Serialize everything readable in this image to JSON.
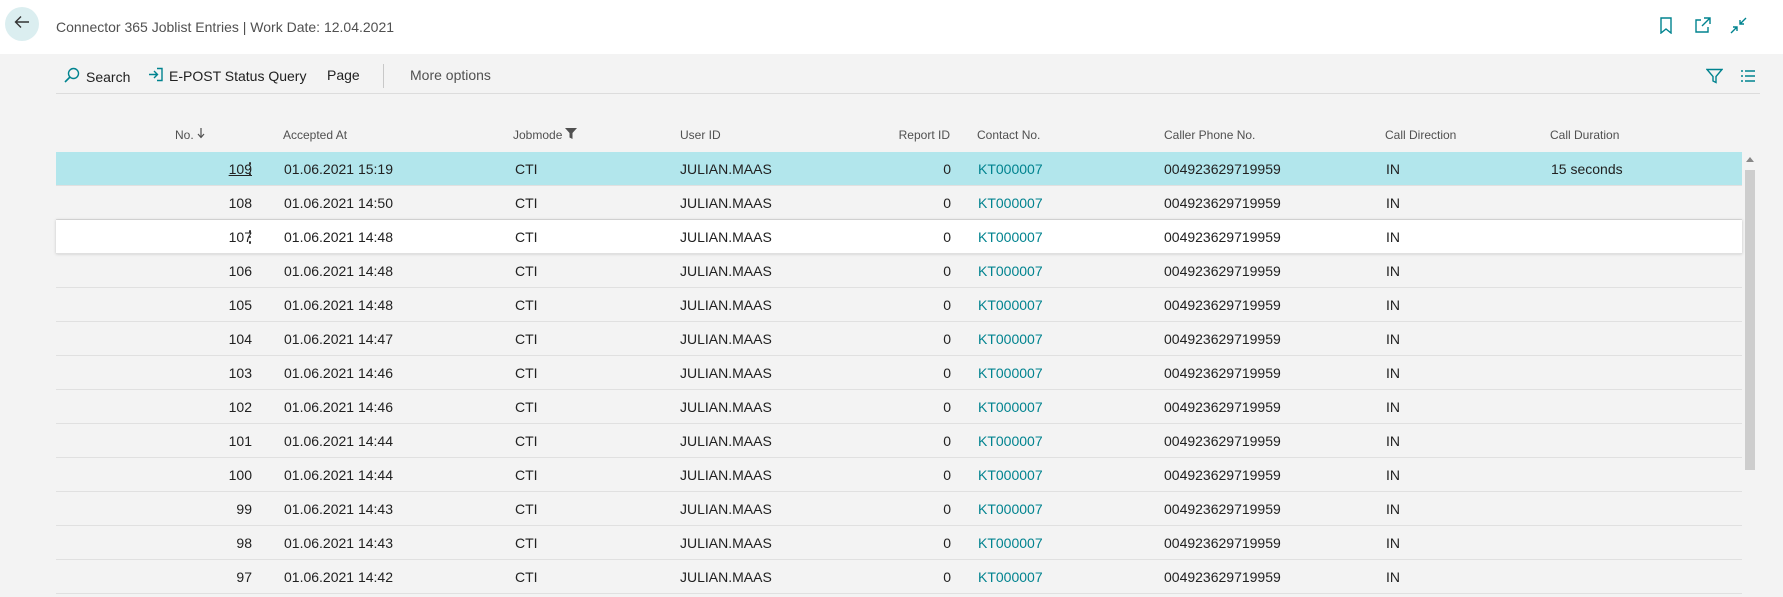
{
  "window": {
    "title": "Connector 365 Joblist Entries | Work Date: 12.04.2021"
  },
  "actions": {
    "search": "Search",
    "epost_status_query": "E-POST Status Query",
    "page": "Page",
    "more_options": "More options"
  },
  "icons": {
    "back": "back-arrow-icon",
    "bookmark": "bookmark-icon",
    "open_new_window": "open-new-window-icon",
    "collapse": "collapse-icon",
    "search": "search-icon",
    "epost": "sign-in-arrow-icon",
    "filter": "filter-icon",
    "list": "list-view-icon",
    "sort": "sort-down-arrow-icon",
    "column_filter": "column-filter-icon"
  },
  "colors": {
    "accent": "#00838f",
    "selected_row": "#b2e6ec"
  },
  "table": {
    "columns": {
      "no": "No.",
      "accepted_at": "Accepted At",
      "jobmode": "Jobmode",
      "user_id": "User ID",
      "report_id": "Report ID",
      "contact_no": "Contact No.",
      "caller_phone": "Caller Phone No.",
      "call_direction": "Call Direction",
      "call_duration": "Call Duration"
    },
    "rows": [
      {
        "no": "109",
        "accepted_at": "01.06.2021 15:19",
        "jobmode": "CTI",
        "user_id": "JULIAN.MAAS",
        "report_id": "0",
        "contact_no": "KT000007",
        "caller_phone": "004923629719959",
        "call_direction": "IN",
        "call_duration": "15 seconds"
      },
      {
        "no": "108",
        "accepted_at": "01.06.2021 14:50",
        "jobmode": "CTI",
        "user_id": "JULIAN.MAAS",
        "report_id": "0",
        "contact_no": "KT000007",
        "caller_phone": "004923629719959",
        "call_direction": "IN",
        "call_duration": ""
      },
      {
        "no": "107",
        "accepted_at": "01.06.2021 14:48",
        "jobmode": "CTI",
        "user_id": "JULIAN.MAAS",
        "report_id": "0",
        "contact_no": "KT000007",
        "caller_phone": "004923629719959",
        "call_direction": "IN",
        "call_duration": ""
      },
      {
        "no": "106",
        "accepted_at": "01.06.2021 14:48",
        "jobmode": "CTI",
        "user_id": "JULIAN.MAAS",
        "report_id": "0",
        "contact_no": "KT000007",
        "caller_phone": "004923629719959",
        "call_direction": "IN",
        "call_duration": ""
      },
      {
        "no": "105",
        "accepted_at": "01.06.2021 14:48",
        "jobmode": "CTI",
        "user_id": "JULIAN.MAAS",
        "report_id": "0",
        "contact_no": "KT000007",
        "caller_phone": "004923629719959",
        "call_direction": "IN",
        "call_duration": ""
      },
      {
        "no": "104",
        "accepted_at": "01.06.2021 14:47",
        "jobmode": "CTI",
        "user_id": "JULIAN.MAAS",
        "report_id": "0",
        "contact_no": "KT000007",
        "caller_phone": "004923629719959",
        "call_direction": "IN",
        "call_duration": ""
      },
      {
        "no": "103",
        "accepted_at": "01.06.2021 14:46",
        "jobmode": "CTI",
        "user_id": "JULIAN.MAAS",
        "report_id": "0",
        "contact_no": "KT000007",
        "caller_phone": "004923629719959",
        "call_direction": "IN",
        "call_duration": ""
      },
      {
        "no": "102",
        "accepted_at": "01.06.2021 14:46",
        "jobmode": "CTI",
        "user_id": "JULIAN.MAAS",
        "report_id": "0",
        "contact_no": "KT000007",
        "caller_phone": "004923629719959",
        "call_direction": "IN",
        "call_duration": ""
      },
      {
        "no": "101",
        "accepted_at": "01.06.2021 14:44",
        "jobmode": "CTI",
        "user_id": "JULIAN.MAAS",
        "report_id": "0",
        "contact_no": "KT000007",
        "caller_phone": "004923629719959",
        "call_direction": "IN",
        "call_duration": ""
      },
      {
        "no": "100",
        "accepted_at": "01.06.2021 14:44",
        "jobmode": "CTI",
        "user_id": "JULIAN.MAAS",
        "report_id": "0",
        "contact_no": "KT000007",
        "caller_phone": "004923629719959",
        "call_direction": "IN",
        "call_duration": ""
      },
      {
        "no": "99",
        "accepted_at": "01.06.2021 14:43",
        "jobmode": "CTI",
        "user_id": "JULIAN.MAAS",
        "report_id": "0",
        "contact_no": "KT000007",
        "caller_phone": "004923629719959",
        "call_direction": "IN",
        "call_duration": ""
      },
      {
        "no": "98",
        "accepted_at": "01.06.2021 14:43",
        "jobmode": "CTI",
        "user_id": "JULIAN.MAAS",
        "report_id": "0",
        "contact_no": "KT000007",
        "caller_phone": "004923629719959",
        "call_direction": "IN",
        "call_duration": ""
      },
      {
        "no": "97",
        "accepted_at": "01.06.2021 14:42",
        "jobmode": "CTI",
        "user_id": "JULIAN.MAAS",
        "report_id": "0",
        "contact_no": "KT000007",
        "caller_phone": "004923629719959",
        "call_direction": "IN",
        "call_duration": ""
      }
    ]
  }
}
